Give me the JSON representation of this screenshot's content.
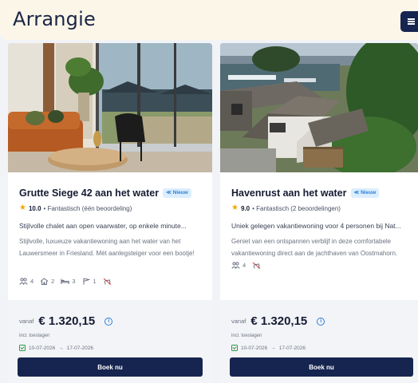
{
  "header": {
    "logo": "Arrangie",
    "colors": {
      "background": "#fbf6e8",
      "logo": "#1b2545",
      "menu": "#16254f"
    }
  },
  "cards": [
    {
      "title": "Grutte Siege 42 aan het water",
      "badge": "≪ Nieuw",
      "rating_score": "10.0",
      "rating_text": "• Fantastisch (één beoordeling)",
      "tagline": "Stijlvolle chalet aan open vaarwater, op enkele minute...",
      "description": "Stijlvolle, luxueuze vakantiewoning aan het water van het Lauwersmeer in Friesland. Mét aanlegsteiger voor een bootje!",
      "amenities": [
        {
          "icon": "people-icon",
          "value": "4"
        },
        {
          "icon": "house-icon",
          "value": "2"
        },
        {
          "icon": "bed-icon",
          "value": "3"
        },
        {
          "icon": "flag-icon",
          "value": "1"
        },
        {
          "icon": "no-pets-icon",
          "value": ""
        }
      ],
      "vanaf": "vanaf",
      "price": "€ 1.320,15",
      "incl": "incl. toeslagen",
      "date_from": "10-07-2026",
      "arrow": "→",
      "date_to": "17-07-2026",
      "cta": "Boek nu"
    },
    {
      "title": "Havenrust aan het water",
      "badge": "≪ Nieuw",
      "rating_score": "9.0",
      "rating_text": "• Fantastisch (2 beoordelingen)",
      "tagline": "Uniek gelegen vakantiewoning voor 4 personen bij Nat...",
      "description": "Geniet van een ontspannen verblijf in deze comfortabele vakantiewoning direct aan de jachthaven van Oostmahorn.",
      "amenities": [
        {
          "icon": "people-icon",
          "value": "4"
        },
        {
          "icon": "no-pets-icon",
          "value": ""
        }
      ],
      "vanaf": "vanaf",
      "price": "€ 1.320,15",
      "incl": "incl. toeslagen",
      "date_from": "10-07-2026",
      "arrow": "→",
      "date_to": "17-07-2026",
      "cta": "Boek nu"
    }
  ],
  "colors": {
    "accent": "#16254f",
    "badge": "#2b7fd6",
    "star": "#f2a800",
    "date_check": "#2e9b48"
  }
}
